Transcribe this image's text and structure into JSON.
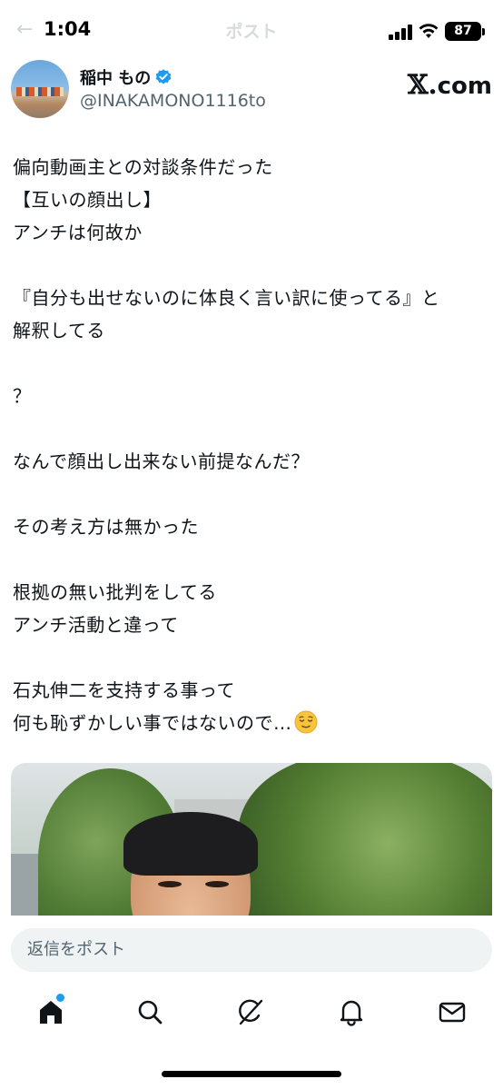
{
  "status_bar": {
    "time": "1:04",
    "battery": "87"
  },
  "ghost_header": {
    "back": "←",
    "title": "ポスト"
  },
  "author": {
    "name": "稲中 もの",
    "handle": "@INAKAMONO1116to",
    "verified": true,
    "site_label": "com",
    "site_glyph": "𝕏."
  },
  "tweet": {
    "lines": [
      "偏向動画主との対談条件だった",
      "【互いの顔出し】",
      "アンチは何故か",
      "",
      "『自分も出せないのに体良く言い訳に使ってる』と",
      "解釈してる",
      "",
      "？",
      "",
      "なんで顔出し出来ない前提なんだ？",
      "",
      "その考え方は無かった",
      "",
      "根拠の無い批判をしてる",
      "アンチ活動と違って",
      "",
      "石丸伸二を支持する事って",
      "何も恥ずかしい事ではないので…"
    ],
    "trailing_emoji": "relieved-face-icon"
  },
  "reply": {
    "placeholder": "返信をポスト"
  },
  "tab_bar": {
    "items": [
      "home-icon",
      "search-icon",
      "grok-icon",
      "notifications-icon",
      "messages-icon"
    ],
    "home_has_dot": true
  },
  "colors": {
    "accent": "#1d9bf0",
    "text": "#0f1419",
    "secondary": "#536471",
    "reply_bg": "#eff3f4"
  }
}
